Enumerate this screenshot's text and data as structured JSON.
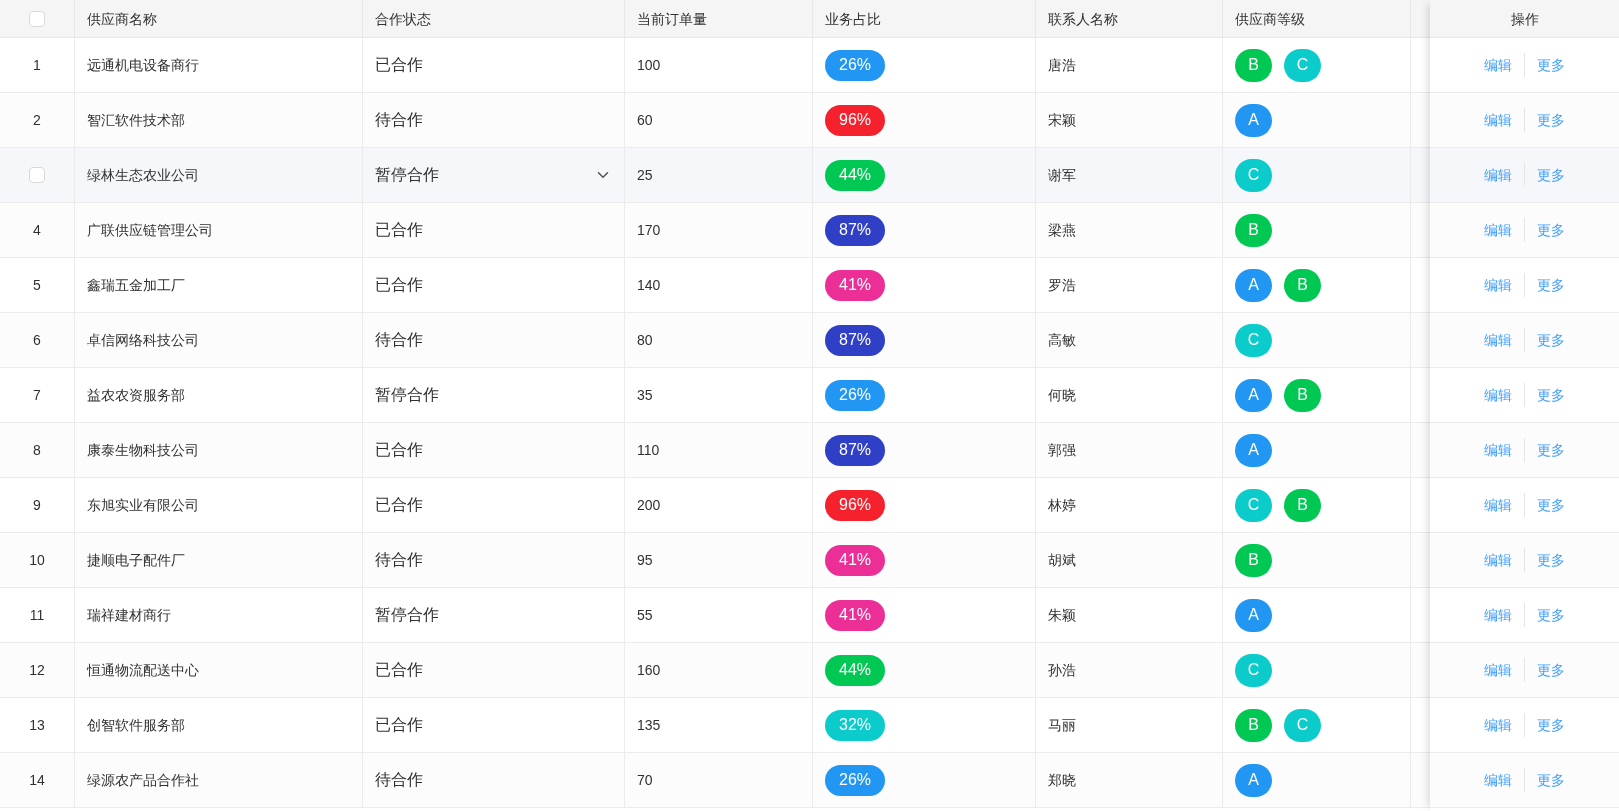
{
  "table": {
    "select_all": {
      "checked": false
    },
    "columns": [
      "供应商名称",
      "合作状态",
      "当前订单量",
      "业务占比",
      "联系人名称",
      "供应商等级"
    ],
    "actions_header": "操作",
    "rows": [
      {
        "index": "1",
        "name": "远通机电设备商行",
        "status": "已合作",
        "orders": "100",
        "share": {
          "text": "26%",
          "color": "#2196f3"
        },
        "contact": "唐浩",
        "grades": [
          {
            "text": "B",
            "color": "#00c853"
          },
          {
            "text": "C",
            "color": "#0ccbcb"
          }
        ],
        "hovered": false,
        "actions": [
          "编辑",
          "更多"
        ]
      },
      {
        "index": "2",
        "name": "智汇软件技术部",
        "status": "待合作",
        "orders": "60",
        "share": {
          "text": "96%",
          "color": "#f5222d"
        },
        "contact": "宋颖",
        "grades": [
          {
            "text": "A",
            "color": "#2196f3"
          }
        ],
        "hovered": false,
        "actions": [
          "编辑",
          "更多"
        ]
      },
      {
        "name": "绿林生态农业公司",
        "status": "暂停合作",
        "orders": "25",
        "share": {
          "text": "44%",
          "color": "#00c853"
        },
        "contact": "谢军",
        "grades": [
          {
            "text": "C",
            "color": "#0ccbcb"
          }
        ],
        "hovered": true,
        "checked": false,
        "actions": [
          "编辑",
          "更多"
        ]
      },
      {
        "index": "4",
        "name": "广联供应链管理公司",
        "status": "已合作",
        "orders": "170",
        "share": {
          "text": "87%",
          "color": "#2f3fc6"
        },
        "contact": "梁燕",
        "grades": [
          {
            "text": "B",
            "color": "#00c853"
          }
        ],
        "hovered": false,
        "actions": [
          "编辑",
          "更多"
        ]
      },
      {
        "index": "5",
        "name": "鑫瑞五金加工厂",
        "status": "已合作",
        "orders": "140",
        "share": {
          "text": "41%",
          "color": "#eb2f96"
        },
        "contact": "罗浩",
        "grades": [
          {
            "text": "A",
            "color": "#2196f3"
          },
          {
            "text": "B",
            "color": "#00c853"
          }
        ],
        "hovered": false,
        "actions": [
          "编辑",
          "更多"
        ]
      },
      {
        "index": "6",
        "name": "卓信网络科技公司",
        "status": "待合作",
        "orders": "80",
        "share": {
          "text": "87%",
          "color": "#2f3fc6"
        },
        "contact": "高敏",
        "grades": [
          {
            "text": "C",
            "color": "#0ccbcb"
          }
        ],
        "hovered": false,
        "actions": [
          "编辑",
          "更多"
        ]
      },
      {
        "index": "7",
        "name": "益农农资服务部",
        "status": "暂停合作",
        "orders": "35",
        "share": {
          "text": "26%",
          "color": "#2196f3"
        },
        "contact": "何晓",
        "grades": [
          {
            "text": "A",
            "color": "#2196f3"
          },
          {
            "text": "B",
            "color": "#00c853"
          }
        ],
        "hovered": false,
        "actions": [
          "编辑",
          "更多"
        ]
      },
      {
        "index": "8",
        "name": "康泰生物科技公司",
        "status": "已合作",
        "orders": "110",
        "share": {
          "text": "87%",
          "color": "#2f3fc6"
        },
        "contact": "郭强",
        "grades": [
          {
            "text": "A",
            "color": "#2196f3"
          }
        ],
        "hovered": false,
        "actions": [
          "编辑",
          "更多"
        ]
      },
      {
        "index": "9",
        "name": "东旭实业有限公司",
        "status": "已合作",
        "orders": "200",
        "share": {
          "text": "96%",
          "color": "#f5222d"
        },
        "contact": "林婷",
        "grades": [
          {
            "text": "C",
            "color": "#0ccbcb"
          },
          {
            "text": "B",
            "color": "#00c853"
          }
        ],
        "hovered": false,
        "actions": [
          "编辑",
          "更多"
        ]
      },
      {
        "index": "10",
        "name": "捷顺电子配件厂",
        "status": "待合作",
        "orders": "95",
        "share": {
          "text": "41%",
          "color": "#eb2f96"
        },
        "contact": "胡斌",
        "grades": [
          {
            "text": "B",
            "color": "#00c853"
          }
        ],
        "hovered": false,
        "actions": [
          "编辑",
          "更多"
        ]
      },
      {
        "index": "11",
        "name": "瑞祥建材商行",
        "status": "暂停合作",
        "orders": "55",
        "share": {
          "text": "41%",
          "color": "#eb2f96"
        },
        "contact": "朱颖",
        "grades": [
          {
            "text": "A",
            "color": "#2196f3"
          }
        ],
        "hovered": false,
        "actions": [
          "编辑",
          "更多"
        ]
      },
      {
        "index": "12",
        "name": "恒通物流配送中心",
        "status": "已合作",
        "orders": "160",
        "share": {
          "text": "44%",
          "color": "#00c853"
        },
        "contact": "孙浩",
        "grades": [
          {
            "text": "C",
            "color": "#0ccbcb"
          }
        ],
        "hovered": false,
        "actions": [
          "编辑",
          "更多"
        ]
      },
      {
        "index": "13",
        "name": "创智软件服务部",
        "status": "已合作",
        "orders": "135",
        "share": {
          "text": "32%",
          "color": "#0ccbcb"
        },
        "contact": "马丽",
        "grades": [
          {
            "text": "B",
            "color": "#00c853"
          },
          {
            "text": "C",
            "color": "#0ccbcb"
          }
        ],
        "hovered": false,
        "actions": [
          "编辑",
          "更多"
        ]
      },
      {
        "index": "14",
        "name": "绿源农产品合作社",
        "status": "待合作",
        "orders": "70",
        "share": {
          "text": "26%",
          "color": "#2196f3"
        },
        "contact": "郑晓",
        "grades": [
          {
            "text": "A",
            "color": "#2196f3"
          }
        ],
        "hovered": false,
        "actions": [
          "编辑",
          "更多"
        ]
      }
    ]
  }
}
